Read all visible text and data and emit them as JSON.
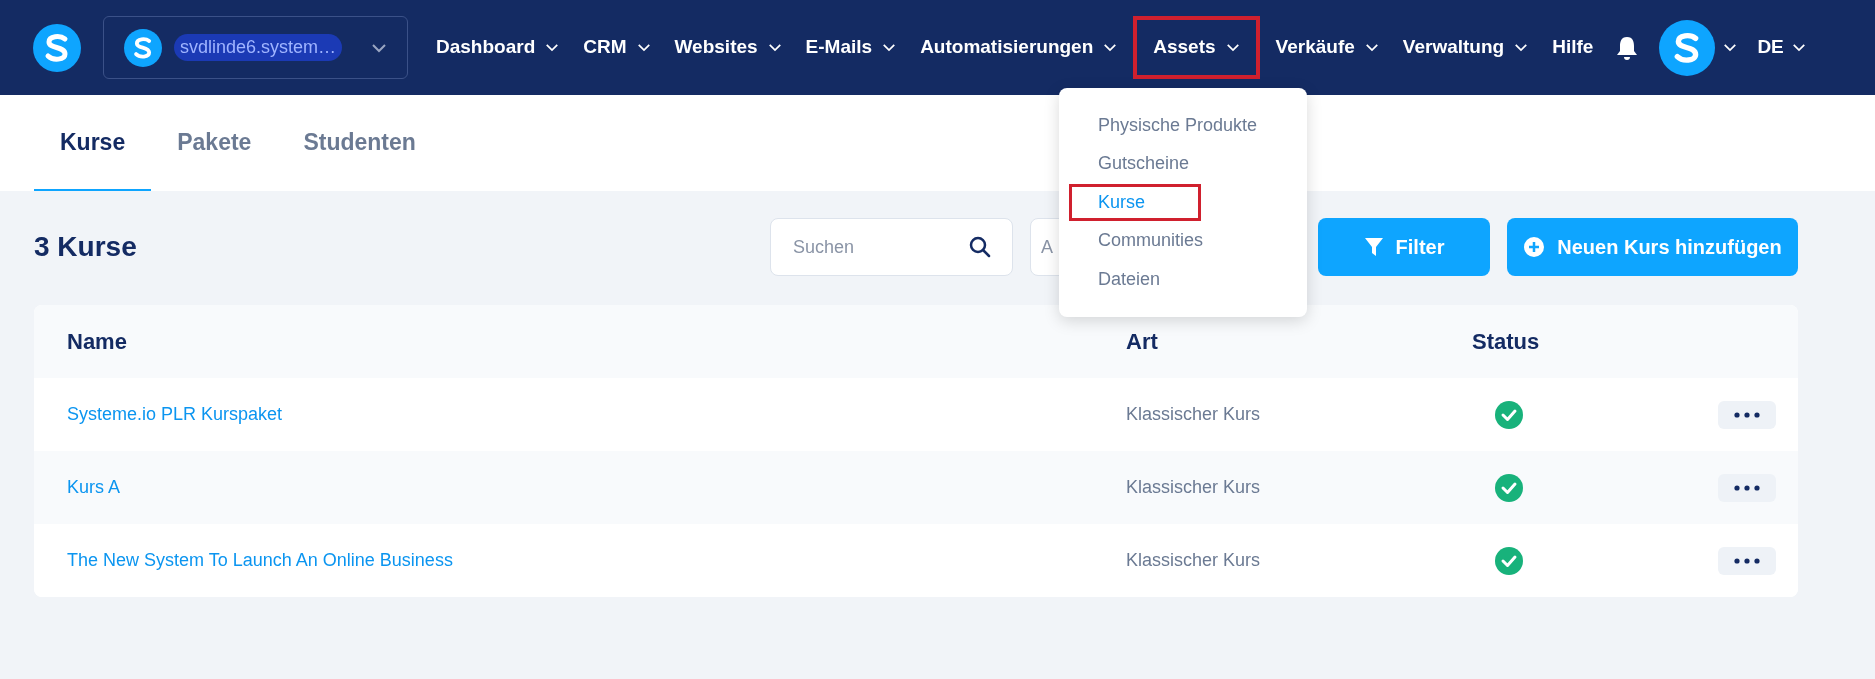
{
  "account": {
    "name": "svdlinde6.system…"
  },
  "nav": [
    {
      "label": "Dashboard",
      "kind": "menu",
      "highlighted": false
    },
    {
      "label": "CRM",
      "kind": "menu",
      "highlighted": false
    },
    {
      "label": "Websites",
      "kind": "menu",
      "highlighted": false
    },
    {
      "label": "E-Mails",
      "kind": "menu",
      "highlighted": false
    },
    {
      "label": "Automatisierungen",
      "kind": "menu",
      "highlighted": false
    },
    {
      "label": "Assets",
      "kind": "menu",
      "highlighted": true
    },
    {
      "label": "Verkäufe",
      "kind": "menu",
      "highlighted": false
    },
    {
      "label": "Verwaltung",
      "kind": "menu",
      "highlighted": false
    },
    {
      "label": "Hilfe",
      "kind": "link",
      "highlighted": false
    }
  ],
  "language": "DE",
  "tabs": [
    {
      "label": "Kurse",
      "selected": true
    },
    {
      "label": "Pakete",
      "selected": false
    },
    {
      "label": "Studenten",
      "selected": false
    }
  ],
  "heading": "3 Kurse",
  "search": {
    "placeholder": "Suchen"
  },
  "second_field": {
    "placeholder": "A"
  },
  "buttons": [
    {
      "kind": "filter",
      "label": "Filter"
    },
    {
      "kind": "add",
      "label": "Neuen Kurs hinzufügen"
    }
  ],
  "dropdown": [
    {
      "label": "Physische Produkte",
      "selected": false
    },
    {
      "label": "Gutscheine",
      "selected": false
    },
    {
      "label": "Kurse",
      "selected": true
    },
    {
      "label": "Communities",
      "selected": false
    },
    {
      "label": "Dateien",
      "selected": false
    }
  ],
  "table": {
    "columns": [
      "Name",
      "Art",
      "Status"
    ],
    "rows": [
      {
        "name": "Systeme.io PLR Kurspaket",
        "art": "Klassischer Kurs",
        "active": true
      },
      {
        "name": "Kurs A",
        "art": "Klassischer Kurs",
        "active": true
      },
      {
        "name": "The New System To Launch An Online Business",
        "art": "Klassischer Kurs",
        "active": true
      }
    ]
  }
}
